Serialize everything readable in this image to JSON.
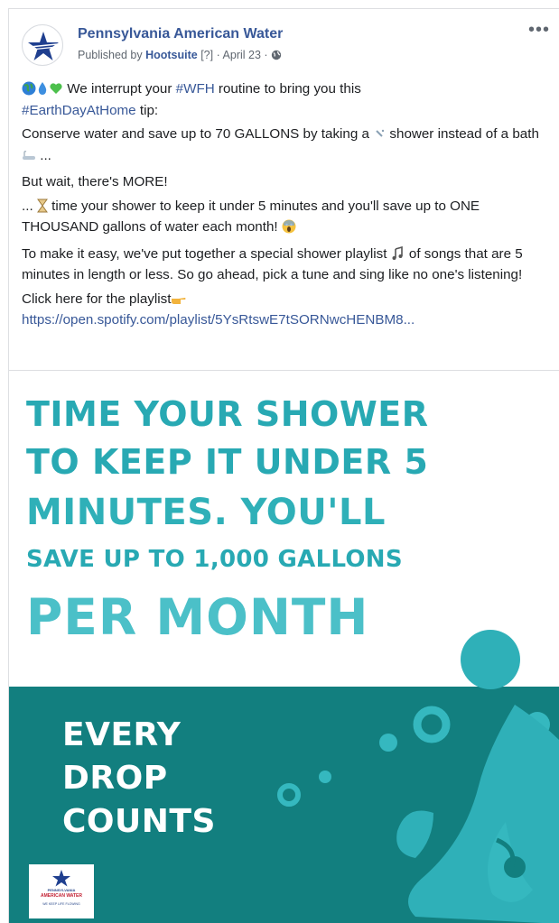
{
  "header": {
    "page_name": "Pennsylvania American Water",
    "published_prefix": "Published by",
    "publisher": "Hootsuite",
    "help_marker": "[?]",
    "separator": "·",
    "date": "April 23",
    "more_label": "•••"
  },
  "post": {
    "p1_text": " We interrupt your ",
    "hashtag_wfh": "#WFH",
    "p1_rest": " routine to bring you this",
    "hashtag_earthday": "#EarthDayAtHome",
    "p1_tail": " tip:",
    "p2_a": "Conserve water and save up to 70 GALLONS by taking a ",
    "p2_b": " shower instead of a bath ",
    "p2_c": " ...",
    "p3": "But wait, there's MORE!",
    "p4_a": "... ",
    "p4_b": " time your shower to keep it under 5 minutes and you'll save up to ONE THOUSAND gallons of water each month! ",
    "p5_a": "To make it easy, we've put together a special shower playlist ",
    "p5_b": " of songs that are 5 minutes in length or less. So go ahead, pick a tune and sing like no one's listening!",
    "p6": "Click here for the playlist",
    "link": "https://open.spotify.com/playlist/5YsRtswE7tSORNwcHENBM8..."
  },
  "image": {
    "line1": "TIME YOUR SHOWER",
    "line2": "TO KEEP IT UNDER 5",
    "line3": "MINUTES. YOU'LL",
    "line4": "SAVE UP TO 1,000 GALLONS",
    "line5": "PER MONTH",
    "banner_line1": "EVERY",
    "banner_line2": "DROP",
    "banner_line3": "COUNTS",
    "logo_line1": "PENNSYLVANIA",
    "logo_line2": "AMERICAN WATER",
    "logo_line3": "WE KEEP LIFE FLOWING"
  },
  "colors": {
    "link": "#385898",
    "headline_teal": "#28a9b3",
    "banner_teal": "#127f7f",
    "splash_teal": "#2fb6bd"
  }
}
